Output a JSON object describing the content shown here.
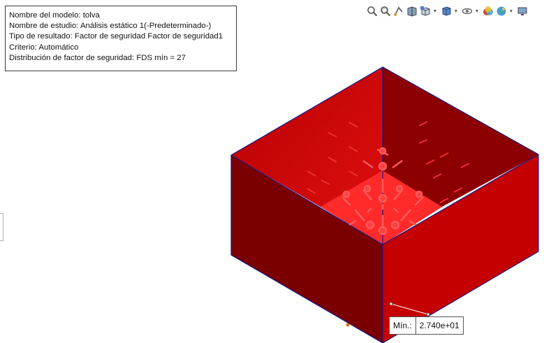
{
  "info": {
    "model_name": "Nombre del modelo: tolva",
    "study_name": "Nombre de estudio: Análisis estático 1(-Predeterminado-)",
    "result_type": "Tipo de resultado: Factor de seguridad Factor de seguridad1",
    "criterion": "Criterio: Automático",
    "distribution": "Distribución de factor de seguridad: FDS mín = 27"
  },
  "toolbar": {
    "icons": [
      "zoom-to-fit-icon",
      "zoom-to-area-icon",
      "previous-view-icon",
      "section-view-icon",
      "view-orientation-icon",
      "display-style-icon",
      "hide-show-items-icon",
      "edit-appearance-icon",
      "apply-scene-icon",
      "view-settings-icon"
    ]
  },
  "model": {
    "face_color": "#cc0000",
    "dark_face_color": "#7a0000",
    "bright_face_color": "#ff2a2a",
    "edge_color": "#1a1a8a"
  },
  "min_annotation": {
    "title": "Mín.:",
    "value": "2.740e+01"
  }
}
